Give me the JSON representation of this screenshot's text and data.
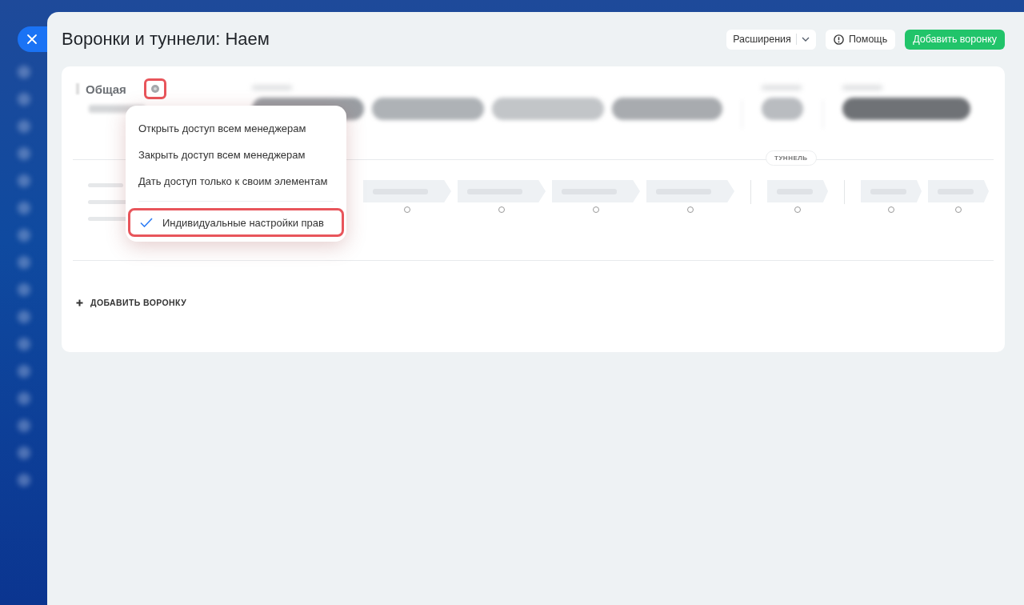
{
  "window": {
    "title": "Воронки и туннели: Наем"
  },
  "header_buttons": [
    {
      "kind": "dropdown",
      "label": "Расширения"
    },
    {
      "kind": "help",
      "label": "Помощь"
    },
    {
      "kind": "primary",
      "label": "Добавить воронку"
    }
  ],
  "funnel": {
    "name": "Общая",
    "tunnel_label": "ТУННЕЛЬ"
  },
  "access_menu": [
    {
      "label": "Открыть доступ всем менеджерам",
      "selected": false
    },
    {
      "label": "Закрыть доступ всем менеджерам",
      "selected": false
    },
    {
      "label": "Дать доступ только к своим элементам",
      "selected": false
    },
    {
      "label": "Индивидуальные настройки прав",
      "selected": true
    }
  ],
  "add_funnel_link": "ДОБАВИТЬ ВОРОНКУ"
}
